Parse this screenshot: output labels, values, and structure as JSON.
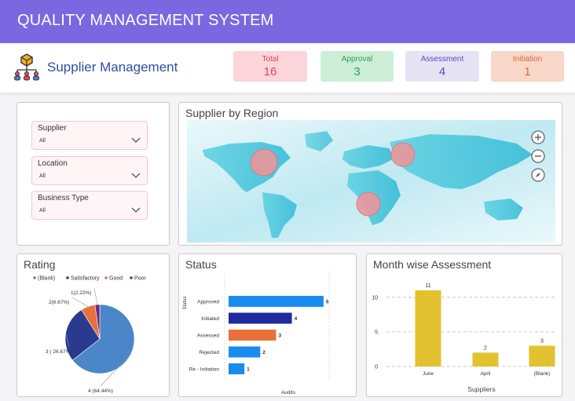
{
  "app": {
    "title": "QUALITY MANAGEMENT SYSTEM",
    "module": "Supplier Management"
  },
  "kpis": [
    {
      "label": "Total",
      "value": "16",
      "bg": "#fbd5d9",
      "color": "#d9455a"
    },
    {
      "label": "Approval",
      "value": "3",
      "bg": "#cdeed6",
      "color": "#2e9e4c"
    },
    {
      "label": "Assessment",
      "value": "4",
      "bg": "#e6e3f5",
      "color": "#5a4bb8"
    },
    {
      "label": "Initiation",
      "value": "1",
      "bg": "#f8d6c8",
      "color": "#d96a3a"
    }
  ],
  "filters": [
    {
      "label": "Supplier",
      "value": "All"
    },
    {
      "label": "Location",
      "value": "All"
    },
    {
      "label": "Business Type",
      "value": "All"
    }
  ],
  "map": {
    "title": "Supplier by Region",
    "icons": [
      "zoom-in-icon",
      "zoom-out-icon",
      "compass-icon"
    ]
  },
  "rating": {
    "title": "Rating"
  },
  "status": {
    "title": "Status"
  },
  "monthwise": {
    "title": "Month wise Assessment"
  },
  "chart_data": [
    {
      "type": "pie",
      "legend": [
        "(Blank)",
        "Satisfactory",
        "Good",
        "Poor"
      ],
      "legend_position": "top",
      "slices": [
        {
          "name": "(Blank)",
          "value": 4,
          "label": "4 (64.44%)",
          "color": "#4a86c8"
        },
        {
          "name": "Satisfactory",
          "value": 3,
          "label": "3 ( 26.67%)",
          "color": "#2a3a8f"
        },
        {
          "name": "Good",
          "value": 2,
          "label": "2(6.67%)",
          "color": "#e8703a"
        },
        {
          "name": "Poor",
          "value": 1,
          "label": "1(2.22%)",
          "color": "#6a2d7c"
        }
      ],
      "fractions": [
        0.6444,
        0.2667,
        0.0667,
        0.0222
      ]
    },
    {
      "type": "bar",
      "orientation": "horizontal",
      "categories": [
        "Approved",
        "Initiated",
        "Assessed",
        "Rejected",
        "Re - Initiation"
      ],
      "values": [
        6,
        4,
        3,
        2,
        1
      ],
      "colors": [
        "#1a8cf0",
        "#1e2a9e",
        "#e8703a",
        "#1a8cf0",
        "#1a8cf0"
      ],
      "xlabel": "Audits",
      "ylabel": "Status",
      "xlim": [
        0,
        6.8
      ]
    },
    {
      "type": "bar",
      "categories": [
        "June",
        "April",
        "(Blank)"
      ],
      "values": [
        11,
        2,
        3
      ],
      "color": "#e2c22e",
      "xlabel": "Suppliers",
      "yticks": [
        0,
        5,
        10
      ],
      "ylim": [
        0,
        11
      ],
      "grid": true
    }
  ]
}
